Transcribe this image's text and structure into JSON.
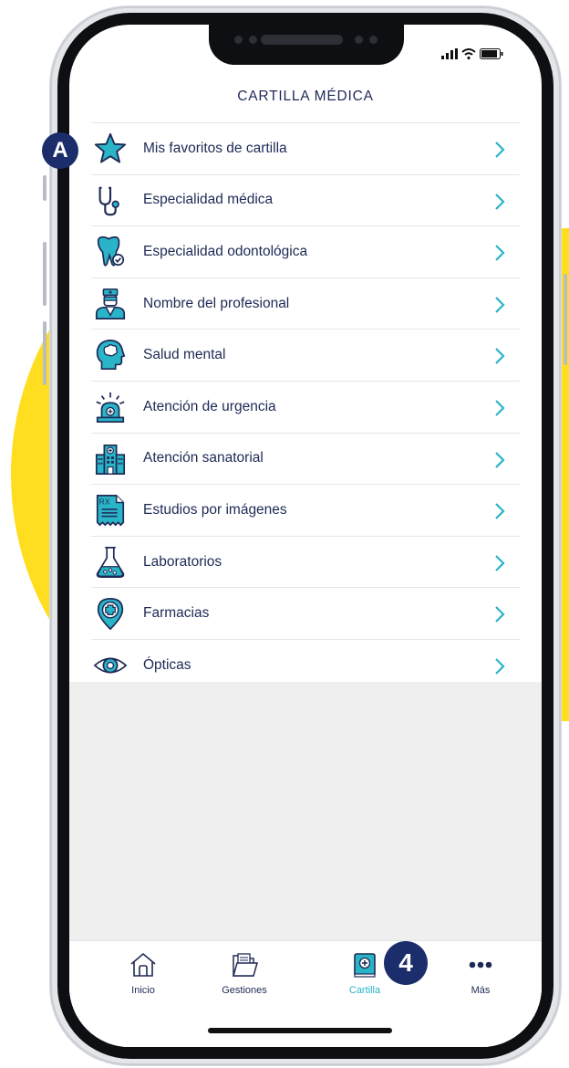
{
  "header": {
    "title": "CARTILLA MÉDICA"
  },
  "menu": [
    {
      "label": "Mis favoritos de cartilla",
      "icon": "star-icon"
    },
    {
      "label": "Especialidad médica",
      "icon": "stethoscope-icon"
    },
    {
      "label": "Especialidad odontológica",
      "icon": "tooth-icon"
    },
    {
      "label": "Nombre del profesional",
      "icon": "doctor-icon"
    },
    {
      "label": "Salud mental",
      "icon": "brain-head-icon"
    },
    {
      "label": "Atención de urgencia",
      "icon": "emergency-siren-icon"
    },
    {
      "label": "Atención sanatorial",
      "icon": "hospital-icon"
    },
    {
      "label": "Estudios por imágenes",
      "icon": "rx-document-icon"
    },
    {
      "label": "Laboratorios",
      "icon": "flask-icon"
    },
    {
      "label": "Farmacias",
      "icon": "pharmacy-pin-icon"
    },
    {
      "label": "Ópticas",
      "icon": "eye-icon"
    }
  ],
  "rx_text": "RX",
  "tabs": [
    {
      "label": "Inicio",
      "icon": "home-icon",
      "active": false
    },
    {
      "label": "Gestiones",
      "icon": "folder-icon",
      "active": false
    },
    {
      "label": "Cartilla",
      "icon": "medical-book-icon",
      "active": true
    },
    {
      "label": "Más",
      "icon": "more-dots-icon",
      "active": false
    }
  ],
  "annotations": {
    "callout_a": "A",
    "callout_4": "4"
  },
  "colors": {
    "accent": "#2ab4c7",
    "navy": "#1e2a55",
    "callout": "#1b2d6b",
    "yellow": "#FFDD1F"
  }
}
